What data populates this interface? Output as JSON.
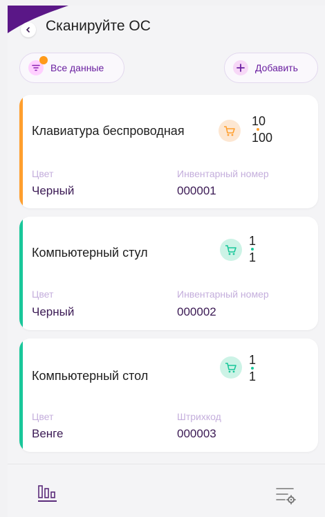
{
  "header": {
    "title": "Сканируйте ОС"
  },
  "filters": {
    "all_data_label": "Все данные",
    "add_label": "Добавить"
  },
  "items": [
    {
      "name": "Клавиатура беспроводная",
      "qty_scanned": "10",
      "qty_total": "100",
      "field1_label": "Цвет",
      "field1_value": "Черный",
      "field2_label": "Инвентарный номер",
      "field2_value": "000001",
      "status_color": "#ff9f2e"
    },
    {
      "name": "Компьютерный стул",
      "qty_scanned": "1",
      "qty_total": "1",
      "field1_label": "Цвет",
      "field1_value": "Черный",
      "field2_label": "Инвентарный номер",
      "field2_value": "000002",
      "status_color": "#19c79a"
    },
    {
      "name": "Компьютерный стол",
      "qty_scanned": "1",
      "qty_total": "1",
      "field1_label": "Цвет",
      "field1_value": "Венге",
      "field2_label": "Штрихкод",
      "field2_value": "000003",
      "status_color": "#19c79a"
    }
  ],
  "colors": {
    "accent": "#6a1fa0",
    "warning": "#ff9f2e",
    "success": "#19c79a"
  },
  "icons": {
    "back": "chevron-left-icon",
    "filter": "filter-icon",
    "add": "plus-icon",
    "cart": "cart-icon",
    "stats": "bar-chart-icon",
    "settings": "list-settings-icon"
  }
}
